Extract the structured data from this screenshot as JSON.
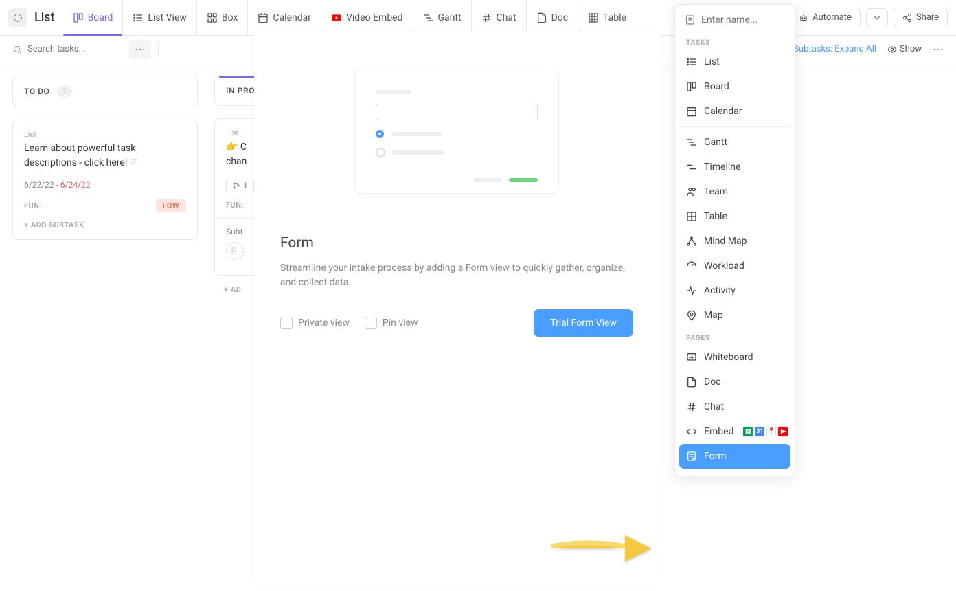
{
  "header": {
    "title": "List",
    "tabs": [
      {
        "label": "Board",
        "icon": "board"
      },
      {
        "label": "List View",
        "icon": "list"
      },
      {
        "label": "Box",
        "icon": "box"
      },
      {
        "label": "Calendar",
        "icon": "calendar"
      },
      {
        "label": "Video Embed",
        "icon": "video"
      },
      {
        "label": "Gantt",
        "icon": "gantt"
      },
      {
        "label": "Chat",
        "icon": "chat"
      },
      {
        "label": "Doc",
        "icon": "doc"
      },
      {
        "label": "Table",
        "icon": "table"
      }
    ],
    "automate": "Automate",
    "share": "Share"
  },
  "secbar": {
    "search_placeholder": "Search tasks...",
    "subtasks": "Subtasks: Expand All",
    "show": "Show"
  },
  "columns": [
    {
      "name": "TO DO",
      "count": "1"
    },
    {
      "name": "IN PROGRESS"
    }
  ],
  "card1": {
    "parent": "List",
    "title": "Learn about powerful task descriptions - click here!",
    "date_start": "6/22/22",
    "date_sep": "-",
    "date_end": "6/24/22",
    "fun": "FUN:",
    "priority": "LOW",
    "add_subtask": "+ ADD SUBTASK"
  },
  "card2": {
    "parent": "List",
    "title_prefix": "👉 C",
    "title_line2": "chan",
    "chip": "1",
    "fun": "FUN:",
    "subtask": "Subt",
    "add": "+ AD"
  },
  "modal": {
    "heading": "Form",
    "desc": "Streamline your intake process by adding a Form view to quickly gather, organize, and collect data.",
    "private": "Private view",
    "pin": "Pin view",
    "trial": "Trial Form View",
    "name_placeholder": "Enter name..."
  },
  "picker": {
    "section1": "TASKS",
    "section2": "PAGES",
    "tasks": [
      "List",
      "Board",
      "Calendar",
      "Gantt",
      "Timeline",
      "Team",
      "Table",
      "Mind Map",
      "Workload",
      "Activity",
      "Map"
    ],
    "pages": [
      "Whiteboard",
      "Doc",
      "Chat",
      "Embed",
      "Form"
    ]
  }
}
